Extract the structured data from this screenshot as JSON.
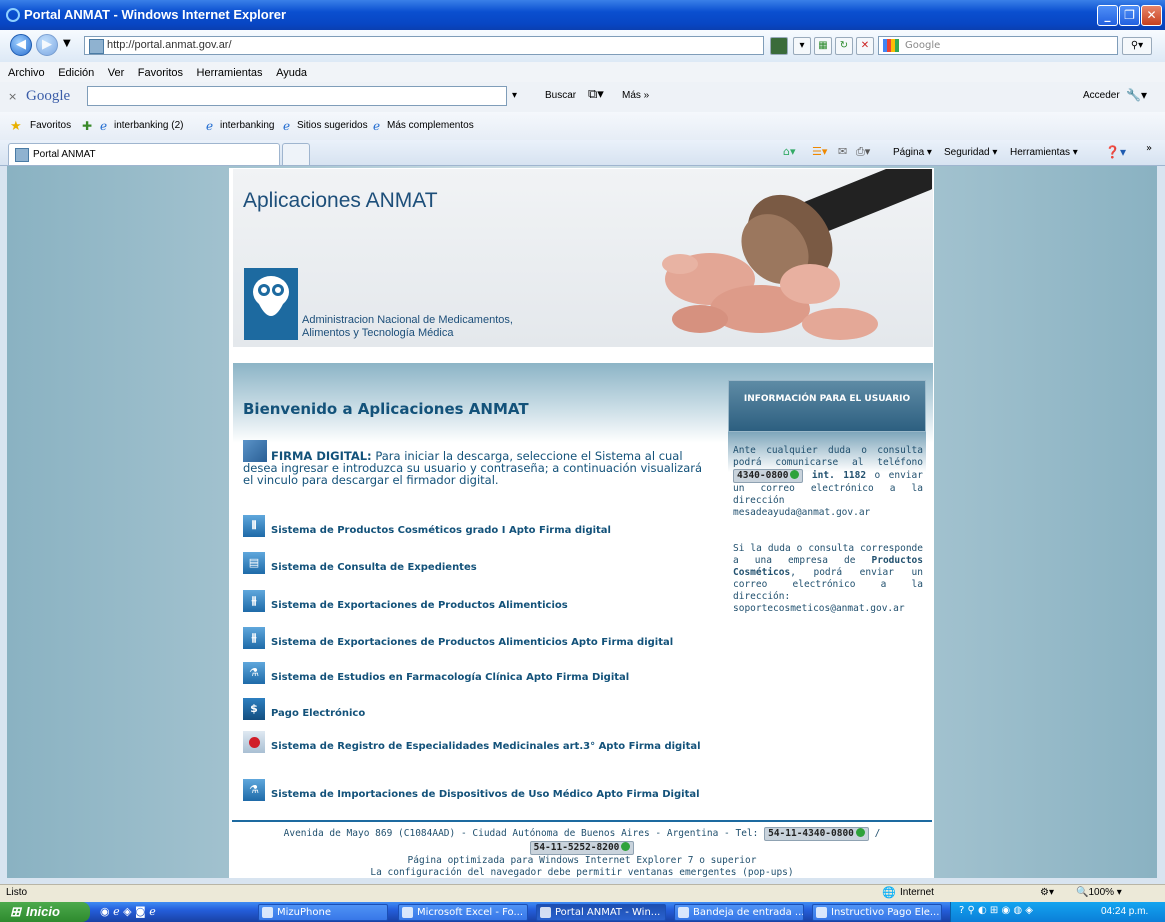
{
  "window": {
    "title": "Portal ANMAT - Windows Internet Explorer"
  },
  "address": {
    "url": "http://portal.anmat.gov.ar/",
    "search_placeholder": "Google"
  },
  "menu": [
    "Archivo",
    "Edición",
    "Ver",
    "Favoritos",
    "Herramientas",
    "Ayuda"
  ],
  "google_toolbar": {
    "logo": "Google",
    "search_button": "Buscar",
    "more": "Más »",
    "sign_in": "Acceder"
  },
  "favorites": {
    "label": "Favoritos",
    "items": [
      "interbanking (2)",
      "interbanking",
      "Sitios sugeridos",
      "Más complementos"
    ]
  },
  "tab": {
    "label": "Portal ANMAT"
  },
  "commandbar": {
    "page": "Página",
    "security": "Seguridad",
    "tools": "Herramientas"
  },
  "page": {
    "header_title": "Aplicaciones ANMAT",
    "logo_line1": "Administracion Nacional de Medicamentos,",
    "logo_line2": "Alimentos y Tecnología Médica",
    "welcome": "Bienvenido a Aplicaciones ANMAT",
    "firma_label": "FIRMA DIGITAL:",
    "firma_text": "Para iniciar la descarga, seleccione el Sistema al cual desea ingresar e introduzca su usuario y contraseña; a continuación visualizará el vinculo para descargar el firmador digital.",
    "apps": [
      {
        "label": "Sistema de Productos Cosméticos grado I Apto Firma digital",
        "icon": "bottles-icon"
      },
      {
        "label": "Sistema de Consulta de Expedientes",
        "icon": "document-icon"
      },
      {
        "label": "Sistema de Exportaciones de Productos Alimenticios",
        "icon": "cutlery-icon"
      },
      {
        "label": "Sistema de Exportaciones de Productos Alimenticios Apto Firma digital",
        "icon": "cutlery-icon"
      },
      {
        "label": "Sistema de Estudios en Farmacología Clínica Apto Firma Digital",
        "icon": "flask-icon"
      },
      {
        "label": "Pago Electrónico",
        "icon": "dollar-icon"
      },
      {
        "label": "Sistema de Registro de Especialidades Medicinales art.3° Apto Firma digital",
        "icon": "pill-icon"
      },
      {
        "label": "Sistema de Importaciones de Dispositivos de Uso Médico Apto Firma Digital",
        "icon": "flask-icon"
      }
    ],
    "info_title": "INFORMACIÓN PARA EL USUARIO",
    "info_p1_a": "Ante cualquier duda o consulta podrá comunicarse al teléfono",
    "info_phone": "4340-0800",
    "info_ext": "int. 1182",
    "info_p1_b": "o enviar un correo electrónico a la dirección mesadeayuda@anmat.gov.ar",
    "info_p2_a": "Si la duda o consulta corresponde a una empresa de",
    "info_p2_bold": "Productos Cosméticos",
    "info_p2_b": ", podrá enviar un correo electrónico a la dirección: soportecosmeticos@anmat.gov.ar",
    "footer_addr": "Avenida de Mayo 869 (C1084AAD) - Ciudad Autónoma de Buenos Aires - Argentina - Tel:",
    "footer_phone1": "54-11-4340-0800",
    "footer_phone2": "54-11-5252-8200",
    "footer_browser": "Página optimizada para Windows Internet Explorer 7 o superior",
    "footer_popups": "La configuración del navegador debe permitir ventanas emergentes (pop-ups)"
  },
  "status": {
    "text": "Listo",
    "zone": "Internet",
    "zoom": "100%"
  },
  "taskbar": {
    "start": "Inicio",
    "buttons": [
      "MizuPhone",
      "Microsoft Excel - Fo...",
      "Portal ANMAT - Win...",
      "Bandeja de entrada ...",
      "Instructivo Pago Ele..."
    ],
    "clock": "04:24 p.m."
  }
}
